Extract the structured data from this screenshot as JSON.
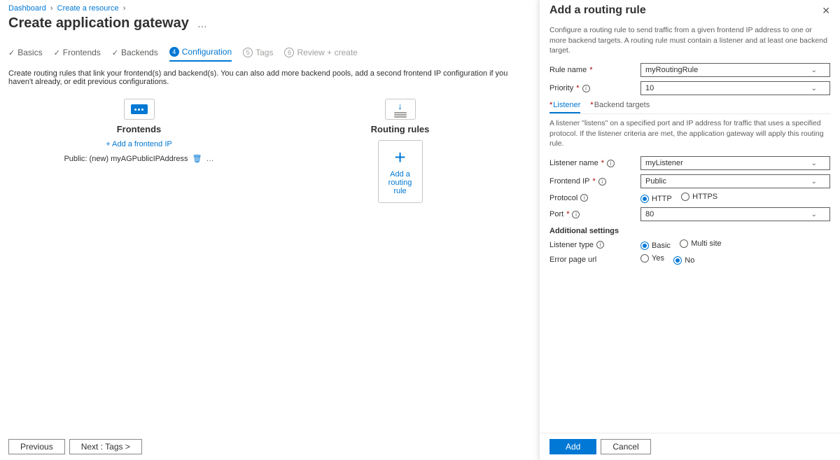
{
  "breadcrumb": [
    "Dashboard",
    "Create a resource"
  ],
  "page_title": "Create application gateway",
  "wizard": [
    {
      "label": "Basics",
      "state": "done"
    },
    {
      "label": "Frontends",
      "state": "done"
    },
    {
      "label": "Backends",
      "state": "done"
    },
    {
      "label": "Configuration",
      "state": "active",
      "num": "4"
    },
    {
      "label": "Tags",
      "state": "pending",
      "num": "5"
    },
    {
      "label": "Review + create",
      "state": "pending",
      "num": "6"
    }
  ],
  "config_desc": "Create routing rules that link your frontend(s) and backend(s). You can also add more backend pools, add a second frontend IP configuration if you haven't already, or edit previous configurations.",
  "frontends": {
    "title": "Frontends",
    "add_link": "+ Add a frontend IP",
    "items": [
      "Public: (new) myAGPublicIPAddress"
    ]
  },
  "routing": {
    "title": "Routing rules",
    "add_label": "Add a routing rule"
  },
  "footer": {
    "prev": "Previous",
    "next": "Next : Tags >"
  },
  "blade": {
    "title": "Add a routing rule",
    "desc": "Configure a routing rule to send traffic from a given frontend IP address to one or more backend targets. A routing rule must contain a listener and at least one backend target.",
    "rule_name_label": "Rule name",
    "rule_name_value": "myRoutingRule",
    "priority_label": "Priority",
    "priority_value": "10",
    "tabs": [
      "Listener",
      "Backend targets"
    ],
    "listener_desc": "A listener \"listens\" on a specified port and IP address for traffic that uses a specified protocol. If the listener criteria are met, the application gateway will apply this routing rule.",
    "listener_name_label": "Listener name",
    "listener_name_value": "myListener",
    "frontend_ip_label": "Frontend IP",
    "frontend_ip_value": "Public",
    "protocol_label": "Protocol",
    "protocol_options": [
      "HTTP",
      "HTTPS"
    ],
    "protocol_selected": "HTTP",
    "port_label": "Port",
    "port_value": "80",
    "additional_heading": "Additional settings",
    "listener_type_label": "Listener type",
    "listener_type_options": [
      "Basic",
      "Multi site"
    ],
    "listener_type_selected": "Basic",
    "error_page_label": "Error page url",
    "error_page_options": [
      "Yes",
      "No"
    ],
    "error_page_selected": "No",
    "add_btn": "Add",
    "cancel_btn": "Cancel"
  }
}
